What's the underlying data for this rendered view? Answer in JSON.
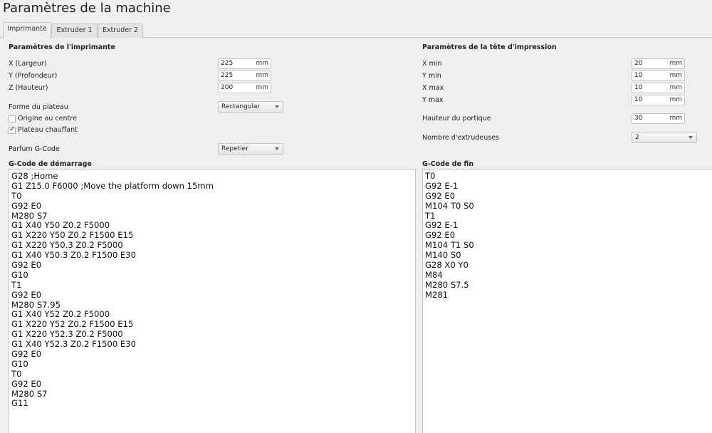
{
  "window": {
    "title": "Paramètres de la machine"
  },
  "tabs": [
    {
      "label": "Imprimante",
      "active": true
    },
    {
      "label": "Extruder 1",
      "active": false
    },
    {
      "label": "Extruder 2",
      "active": false
    }
  ],
  "printer": {
    "section_title": "Paramètres de l'imprimante",
    "x_label": "X (Largeur)",
    "x_value": "225",
    "x_unit": "mm",
    "y_label": "Y (Profondeur)",
    "y_value": "225",
    "y_unit": "mm",
    "z_label": "Z (Hauteur)",
    "z_value": "200",
    "z_unit": "mm",
    "plate_shape_label": "Forme du plateau",
    "plate_shape_value": "Rectangular",
    "origin_center_label": "Origine au centre",
    "origin_center_checked": false,
    "heated_bed_label": "Plateau chauffant",
    "heated_bed_checked": true,
    "gcode_flavor_label": "Parfum G-Code",
    "gcode_flavor_value": "Repetier"
  },
  "printhead": {
    "section_title": "Paramètres de la tête d'impression",
    "xmin_label": "X min",
    "xmin_value": "20",
    "xmin_unit": "mm",
    "ymin_label": "Y min",
    "ymin_value": "10",
    "ymin_unit": "mm",
    "xmax_label": "X max",
    "xmax_value": "10",
    "xmax_unit": "mm",
    "ymax_label": "Y max",
    "ymax_value": "10",
    "ymax_unit": "mm",
    "gantry_label": "Hauteur du portique",
    "gantry_value": "30",
    "gantry_unit": "mm",
    "extruders_label": "Nombre d'extrudeuses",
    "extruders_value": "2"
  },
  "start_gcode": {
    "title": "G-Code de démarrage",
    "lines": [
      "G28 ;Home",
      "G1 Z15.0 F6000 ;Move the platform down 15mm",
      "T0",
      "G92 E0",
      "M280 S7",
      "G1 X40 Y50 Z0.2 F5000",
      "G1 X220 Y50 Z0.2 F1500 E15",
      "G1 X220 Y50.3 Z0.2 F5000",
      "G1 X40 Y50.3 Z0.2 F1500 E30",
      "G92 E0",
      "G10",
      "T1",
      "G92 E0",
      "M280 S7.95",
      "G1 X40 Y52 Z0.2 F5000",
      "G1 X220 Y52 Z0.2 F1500 E15",
      "G1 X220 Y52.3 Z0.2 F5000",
      "G1 X40 Y52.3 Z0.2 F1500 E30",
      "G92 E0",
      "G10",
      "T0",
      "G92 E0",
      "M280 S7",
      "G11"
    ]
  },
  "end_gcode": {
    "title": "G-Code de fin",
    "lines": [
      "T0",
      "G92 E-1",
      "G92 E0",
      "M104 T0 S0",
      "T1",
      "G92 E-1",
      "G92 E0",
      "M104 T1 S0",
      "M140 S0",
      "G28 X0 Y0",
      "M84",
      "M280 S7.5",
      "M281"
    ]
  }
}
